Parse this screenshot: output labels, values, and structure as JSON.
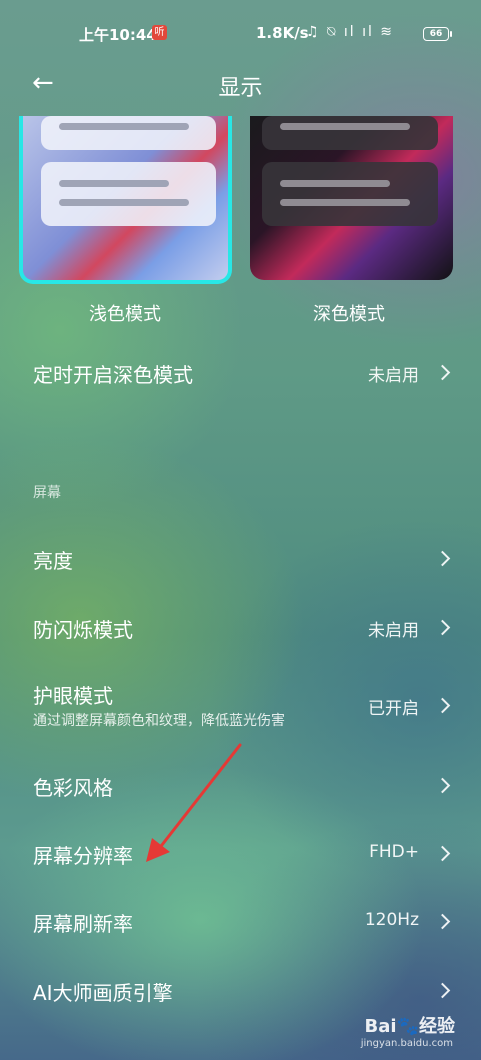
{
  "status_bar": {
    "time": "上午10:44",
    "app_badge": "听",
    "network_speed": "1.8K/s",
    "icons": [
      "headphones-icon",
      "mute-icon",
      "hd-signal-icon",
      "hd-signal-icon",
      "wifi-icon"
    ],
    "icons_text": "♫ ⍉ ıl ıl ≋",
    "battery": "66"
  },
  "header": {
    "back": "←",
    "title": "显示"
  },
  "theme_previews": {
    "light_label": "浅色模式",
    "dark_label": "深色模式",
    "selected": "浅色模式",
    "accent": "#28e7e6"
  },
  "dark_schedule": {
    "label": "定时开启深色模式",
    "value": "未启用"
  },
  "section_screen": "屏幕",
  "settings": {
    "brightness": {
      "label": "亮度"
    },
    "anti_flicker": {
      "label": "防闪烁模式",
      "value": "未启用"
    },
    "eye_care": {
      "label": "护眼模式",
      "sub": "通过调整屏幕颜色和纹理，降低蓝光伤害",
      "value": "已开启"
    },
    "color_style": {
      "label": "色彩风格"
    },
    "resolution": {
      "label": "屏幕分辨率",
      "value": "FHD+"
    },
    "refresh_rate": {
      "label": "屏幕刷新率",
      "value": "120Hz"
    },
    "ai_engine": {
      "label": "AI大师画质引擎"
    }
  },
  "annotation_color": "#e53935",
  "watermark": {
    "brand": "Bai🐾经验",
    "url": "jingyan.baidu.com"
  }
}
